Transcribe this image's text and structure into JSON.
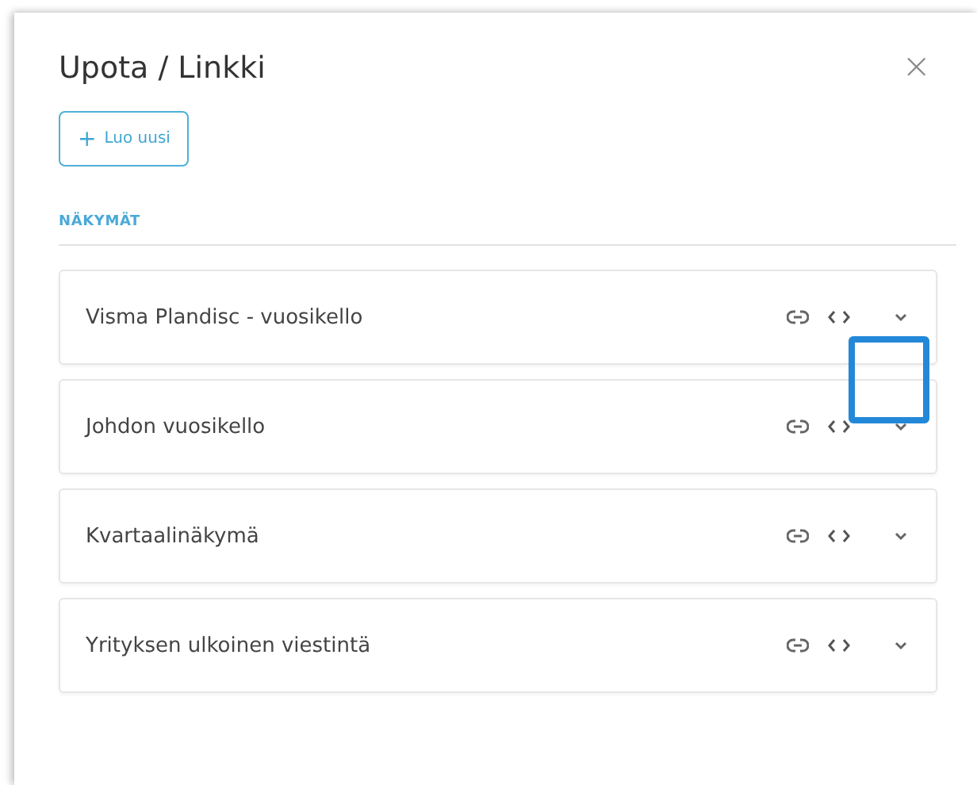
{
  "dialog": {
    "title": "Upota / Linkki",
    "close_label": "×",
    "new_button": {
      "icon": "+",
      "label": "Luo uusi"
    },
    "section_heading": "NÄKYMÄT"
  },
  "views": [
    {
      "name": "Visma Plandisc - vuosikello",
      "highlighted": false
    },
    {
      "name": "Johdon vuosikello",
      "highlighted": true
    },
    {
      "name": "Kvartaalinäkymä",
      "highlighted": false
    },
    {
      "name": "Yrityksen ulkoinen viestintä",
      "highlighted": false
    }
  ]
}
